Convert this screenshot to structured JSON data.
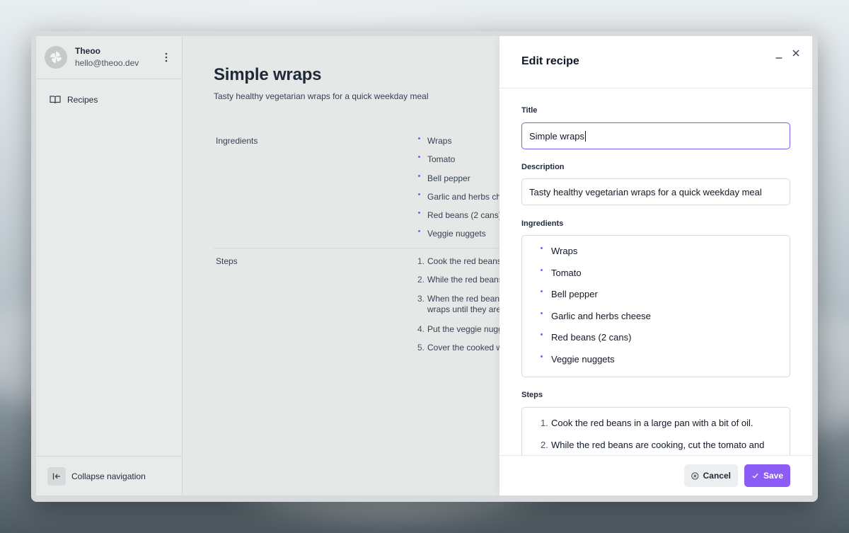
{
  "user": {
    "name": "Theoo",
    "email": "hello@theoo.dev"
  },
  "sidebar": {
    "items": [
      {
        "label": "Recipes",
        "icon": "book-icon"
      }
    ],
    "collapse_label": "Collapse navigation"
  },
  "recipe": {
    "title": "Simple wraps",
    "description": "Tasty healthy vegetarian wraps for a quick weekday meal",
    "ingredients_label": "Ingredients",
    "steps_label": "Steps",
    "ingredients": [
      "Wraps",
      "Tomato",
      "Bell pepper",
      "Garlic and herbs che",
      "Red beans (2 cans)",
      "Veggie nuggets"
    ],
    "steps": [
      {
        "num": "1.",
        "text": "Cook the red beans"
      },
      {
        "num": "2.",
        "text": "While the red beans"
      },
      {
        "num": "3.",
        "text": "When the red beans",
        "text2": "wraps until they are"
      },
      {
        "num": "4.",
        "text": "Put the veggie nugg"
      },
      {
        "num": "5.",
        "text": "Cover the cooked w"
      }
    ]
  },
  "drawer": {
    "title": "Edit recipe",
    "title_label": "Title",
    "title_value": "Simple wraps",
    "description_label": "Description",
    "description_value": "Tasty healthy vegetarian wraps for a quick weekday meal",
    "ingredients_label": "Ingredients",
    "ingredients": [
      "Wraps",
      "Tomato",
      "Bell pepper",
      "Garlic and herbs cheese",
      "Red beans (2 cans)",
      "Veggie nuggets"
    ],
    "steps_label": "Steps",
    "steps": [
      {
        "num": "1.",
        "text": "Cook the red beans in a large pan with a bit of oil."
      },
      {
        "num": "2.",
        "text": "While the red beans are cooking, cut the tomato and"
      }
    ],
    "cancel_label": "Cancel",
    "save_label": "Save"
  },
  "colors": {
    "accent": "#8b5cf6",
    "focus_border": "#7c5cf3",
    "bullet": "#7c5cf3"
  }
}
